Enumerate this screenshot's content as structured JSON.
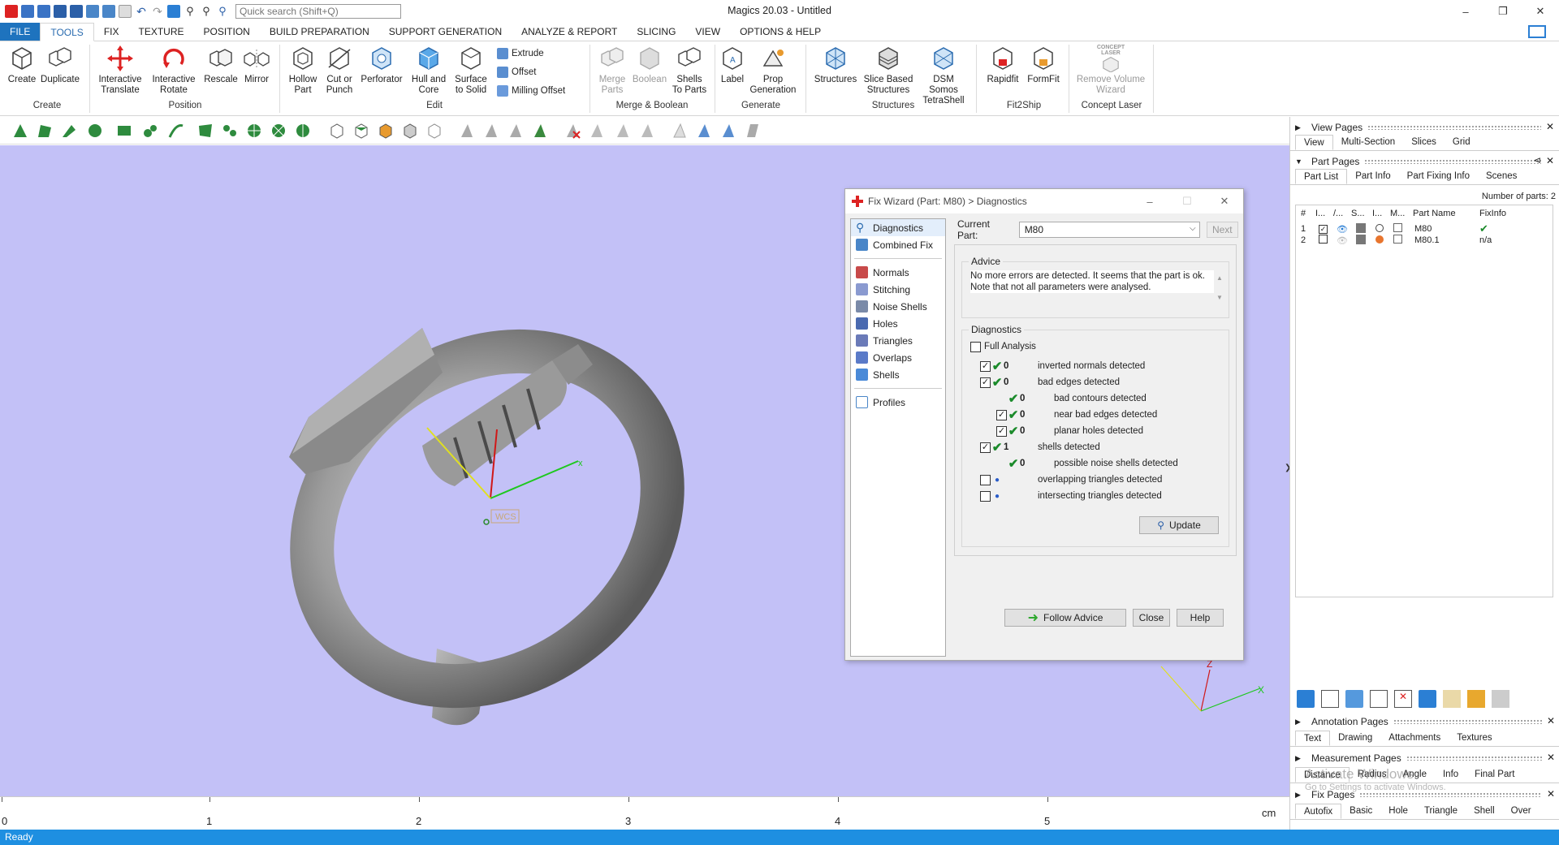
{
  "window": {
    "title": "Magics 20.03 - Untitled",
    "search_placeholder": "Quick search (Shift+Q)",
    "minimize": "–",
    "restore": "❐",
    "close": "✕"
  },
  "menu": {
    "tabs": [
      "FILE",
      "TOOLS",
      "FIX",
      "TEXTURE",
      "POSITION",
      "BUILD PREPARATION",
      "SUPPORT GENERATION",
      "ANALYZE & REPORT",
      "SLICING",
      "VIEW",
      "OPTIONS & HELP"
    ],
    "active": "TOOLS"
  },
  "ribbon": {
    "create": {
      "label": "Create",
      "buttons": [
        "Create",
        "Duplicate"
      ]
    },
    "position": {
      "label": "Position",
      "interactive_translate": [
        "Interactive",
        "Translate"
      ],
      "interactive_rotate": [
        "Interactive",
        "Rotate"
      ],
      "rescale": "Rescale",
      "mirror": "Mirror"
    },
    "edit": {
      "label": "Edit",
      "hollow": [
        "Hollow",
        "Part"
      ],
      "cut": [
        "Cut or",
        "Punch"
      ],
      "perforator": "Perforator",
      "hull": [
        "Hull and",
        "Core"
      ],
      "surface": [
        "Surface",
        "to Solid"
      ],
      "extrude": "Extrude",
      "offset": "Offset",
      "milling": "Milling Offset"
    },
    "merge": {
      "label": "Merge & Boolean",
      "merge_parts": [
        "Merge",
        "Parts"
      ],
      "boolean": "Boolean",
      "shells": [
        "Shells",
        "To Parts"
      ]
    },
    "generate": {
      "label": "Generate",
      "label_btn": "Label",
      "prop": [
        "Prop",
        "Generation"
      ]
    },
    "structures": {
      "label": "Structures",
      "structures": "Structures",
      "slice_based": [
        "Slice Based",
        "Structures"
      ],
      "dsm": [
        "DSM Somos",
        "TetraShell"
      ]
    },
    "fit2ship": {
      "label": "Fit2Ship",
      "rapidfit": "Rapidfit",
      "formfit": "FormFit"
    },
    "concept": {
      "label": "Concept Laser",
      "logo": "CONCEPT LASER",
      "remove": [
        "Remove Volume",
        "Wizard"
      ]
    }
  },
  "viewport": {
    "wcs_label": "WCS",
    "axis_x": "x",
    "axis_z": "Z",
    "axis_x2": "X"
  },
  "ruler": {
    "labels": [
      "0",
      "1",
      "2",
      "3",
      "4",
      "5"
    ],
    "unit": "cm"
  },
  "status": {
    "text": "Ready"
  },
  "dialog": {
    "title": "Fix Wizard (Part: M80) > Diagnostics",
    "nav_top": [
      "Diagnostics",
      "Combined Fix"
    ],
    "nav_mid": [
      "Normals",
      "Stitching",
      "Noise Shells",
      "Holes",
      "Triangles",
      "Overlaps",
      "Shells"
    ],
    "nav_bottom": [
      "Profiles"
    ],
    "current_part_label": "Current Part:",
    "current_part_value": "M80",
    "next": "Next",
    "advice_legend": "Advice",
    "advice_text": "No more errors are detected. It seems that the part is ok. Note that not all parameters were analysed.",
    "diagnostics_legend": "Diagnostics",
    "full_analysis": "Full Analysis",
    "rows": [
      {
        "checked": true,
        "count": "0",
        "label": "inverted normals detected",
        "level": 0
      },
      {
        "checked": true,
        "count": "0",
        "label": "bad edges detected",
        "level": 0
      },
      {
        "checked": false,
        "count": "0",
        "label": "bad contours detected",
        "level": 1,
        "nobox": true
      },
      {
        "checked": true,
        "count": "0",
        "label": "near bad edges detected",
        "level": 1
      },
      {
        "checked": true,
        "count": "0",
        "label": "planar holes detected",
        "level": 1
      },
      {
        "checked": true,
        "count": "1",
        "label": "shells detected",
        "level": 0
      },
      {
        "checked": false,
        "count": "0",
        "label": "possible noise shells detected",
        "level": 1,
        "nobox": true
      },
      {
        "checked": false,
        "count": "",
        "label": "overlapping triangles detected",
        "level": 0,
        "dot": true
      },
      {
        "checked": false,
        "count": "",
        "label": "intersecting triangles detected",
        "level": 0,
        "dot": true
      }
    ],
    "update": "Update",
    "follow_advice": "Follow Advice",
    "close": "Close",
    "help": "Help"
  },
  "rpanel": {
    "view_pages": "View Pages",
    "view_tabs": [
      "View",
      "Multi-Section",
      "Slices",
      "Grid"
    ],
    "part_pages": "Part Pages",
    "part_tabs": [
      "Part List",
      "Part Info",
      "Part Fixing Info",
      "Scenes"
    ],
    "num_parts": "Number of parts: 2",
    "columns": [
      "#",
      "I...",
      "/...",
      "S...",
      "I...",
      "M...",
      "Part Name",
      "FixInfo"
    ],
    "parts": [
      {
        "num": "1",
        "name": "M80",
        "fix": "✔"
      },
      {
        "num": "2",
        "name": "M80.1",
        "fix": "n/a"
      }
    ],
    "annotation_pages": "Annotation Pages",
    "annotation_tabs": [
      "Text",
      "Drawing",
      "Attachments",
      "Textures"
    ],
    "measurement_pages": "Measurement Pages",
    "measurement_tabs": [
      "Distance",
      "Radius",
      "Angle",
      "Info",
      "Final Part"
    ],
    "fix_pages": "Fix Pages",
    "fix_tabs": [
      "Autofix",
      "Basic",
      "Hole",
      "Triangle",
      "Shell",
      "Over"
    ],
    "watermark1": "Activate Windows",
    "watermark2": "Go to Settings to activate Windows."
  },
  "colors": {
    "viewport_bg": "#c3c1f7",
    "accent": "#1e73be",
    "status": "#1e8fe1",
    "check_green": "#1a8a2a"
  }
}
